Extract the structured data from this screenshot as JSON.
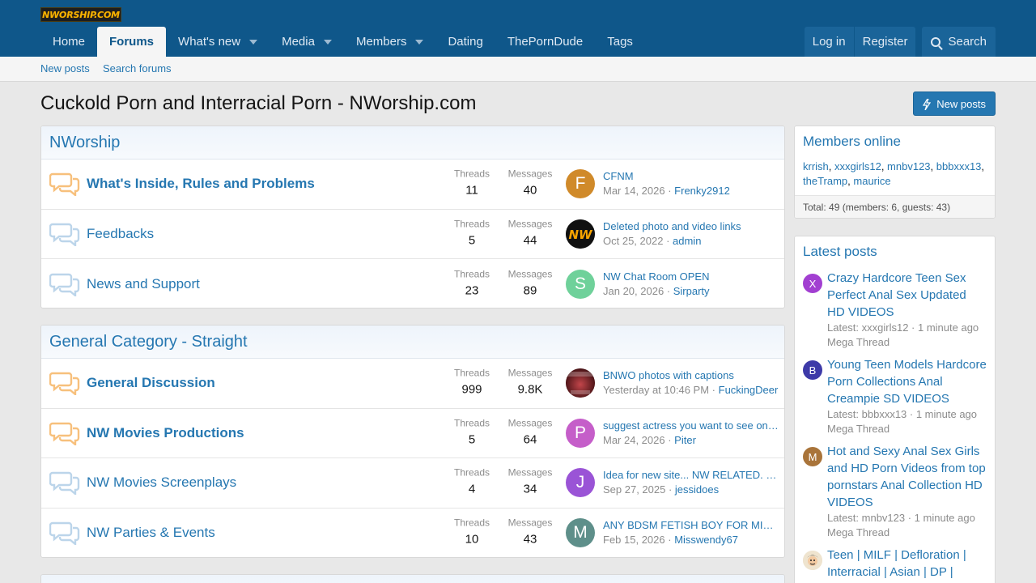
{
  "logo": {
    "text": "NWORSHIP.COM"
  },
  "nav": {
    "tabs": [
      {
        "label": "Home"
      },
      {
        "label": "Forums"
      },
      {
        "label": "What's new"
      },
      {
        "label": "Media"
      },
      {
        "label": "Members"
      },
      {
        "label": "Dating"
      },
      {
        "label": "ThePornDude"
      },
      {
        "label": "Tags"
      }
    ],
    "login": "Log in",
    "register": "Register",
    "search": "Search"
  },
  "subnav": {
    "new_posts": "New posts",
    "search_forums": "Search forums"
  },
  "page": {
    "title": "Cuckold Porn and Interracial Porn - NWorship.com",
    "new_posts_button": "New posts"
  },
  "labels": {
    "threads": "Threads",
    "messages": "Messages"
  },
  "categories": [
    {
      "title": "NWorship",
      "forums": [
        {
          "title": "What's Inside, Rules and Problems",
          "threads": "11",
          "messages": "40",
          "last_title": "CFNM",
          "last_date": "Mar 14, 2026",
          "last_user": "Frenky2912",
          "avatar_letter": "F",
          "avatar_color": "#d08a2a"
        },
        {
          "title": "Feedbacks",
          "threads": "5",
          "messages": "44",
          "last_title": "Deleted photo and video links",
          "last_date": "Oct 25, 2022",
          "last_user": "admin",
          "avatar_letter": "",
          "avatar_color": "#111111"
        },
        {
          "title": "News and Support",
          "threads": "23",
          "messages": "89",
          "last_title": "NW Chat Room OPEN",
          "last_date": "Jan 20, 2026",
          "last_user": "Sirparty",
          "avatar_letter": "S",
          "avatar_color": "#6fd19a"
        }
      ]
    },
    {
      "title": "General Category - Straight",
      "forums": [
        {
          "title": "General Discussion",
          "threads": "999",
          "messages": "9.8K",
          "last_title": "BNWO photos with captions",
          "last_date": "Yesterday at 10:46 PM",
          "last_user": "FuckingDeer",
          "avatar_letter": "",
          "avatar_color": "#5a1a1a"
        },
        {
          "title": "NW Movies Productions",
          "threads": "5",
          "messages": "64",
          "last_title": "suggest actress you want to see on NW",
          "last_date": "Mar 24, 2026",
          "last_user": "Piter",
          "avatar_letter": "P",
          "avatar_color": "#c55ec9"
        },
        {
          "title": "NW Movies Screenplays",
          "threads": "4",
          "messages": "34",
          "last_title": "Idea for new site... NW RELATED. Need feedback",
          "last_date": "Sep 27, 2025",
          "last_user": "jessidoes",
          "avatar_letter": "J",
          "avatar_color": "#9a54d6"
        },
        {
          "title": "NW Parties & Events",
          "threads": "10",
          "messages": "43",
          "last_title": "ANY BDSM FETISH BOY FOR MISTRESS",
          "last_date": "Feb 15, 2026",
          "last_user": "Misswendy67",
          "avatar_letter": "M",
          "avatar_color": "#5e8f8a"
        }
      ]
    }
  ],
  "members_online": {
    "title": "Members online",
    "users": [
      "krrish",
      "xxxgirls12",
      "mnbv123",
      "bbbxxx13",
      "theTramp",
      "maurice"
    ],
    "total": "Total: 49 (members: 6, guests: 43)"
  },
  "latest_posts": {
    "title": "Latest posts",
    "items": [
      {
        "title": "Crazy Hardcore Teen Sex Perfect Anal Sex Updated HD VIDEOS",
        "meta": "Latest: xxxgirls12 · 1 minute ago",
        "forum": "Mega Thread",
        "avatar_letter": "X",
        "avatar_color": "#a23fd1"
      },
      {
        "title": "Young Teen Models Hardcore Porn Collections Anal Creampie SD VIDEOS",
        "meta": "Latest: bbbxxx13 · 1 minute ago",
        "forum": "Mega Thread",
        "avatar_letter": "B",
        "avatar_color": "#3d3aa8"
      },
      {
        "title": "Hot and Sexy Anal Sex Girls and HD Porn Videos from top pornstars Anal Collection HD VIDEOS",
        "meta": "Latest: mnbv123 · 1 minute ago",
        "forum": "Mega Thread",
        "avatar_letter": "M",
        "avatar_color": "#a9743a"
      },
      {
        "title": "Teen | MILF | Defloration | Interracial | Asian | DP |",
        "meta": "",
        "forum": "",
        "avatar_letter": "",
        "avatar_color": "#e8dcc8"
      }
    ]
  }
}
